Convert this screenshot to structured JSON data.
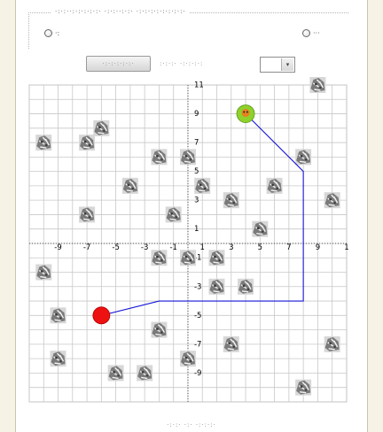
{
  "header": {
    "legend": "·:·:··:·:·:·:·:·  ·:·:··:·:·  ·:·:·:·:·:·:·:·:·",
    "option_left_label": "·:",
    "option_right_label": "···",
    "generate_button": "·:·:·:·:·:·",
    "level_label": ":·:·:· ·:·:·:·:",
    "level_value": ""
  },
  "footer": {
    "text": "·:·:· ·:· ·:·:·:·"
  },
  "board": {
    "x_range": [
      -11,
      11
    ],
    "y_range": [
      -11,
      11
    ],
    "grid_step": 1,
    "x_ticks": [
      "-9",
      "-7",
      "-5",
      "-3",
      "-1",
      "1",
      "3",
      "5",
      "7",
      "9",
      "1"
    ],
    "y_ticks": [
      "11",
      "9",
      "7",
      "5",
      "3",
      "1",
      "-1",
      "-3",
      "-5",
      "-7",
      "-9"
    ],
    "start_point": {
      "x": 4,
      "y": 9,
      "color": "#8fd12b"
    },
    "goal_point": {
      "x": -6,
      "y": -5,
      "color": "#ee1111"
    },
    "path_color": "#1515d6",
    "path": [
      [
        4,
        9
      ],
      [
        8,
        5
      ],
      [
        8,
        -4
      ],
      [
        -2,
        -4
      ],
      [
        -6,
        -5
      ]
    ],
    "obstacle_icon": "boulder-icon",
    "obstacles": [
      [
        9,
        11
      ],
      [
        -6,
        8
      ],
      [
        -10,
        7
      ],
      [
        -7,
        7
      ],
      [
        -2,
        6
      ],
      [
        0,
        6
      ],
      [
        8,
        6
      ],
      [
        -4,
        4
      ],
      [
        1,
        4
      ],
      [
        3,
        3
      ],
      [
        6,
        4
      ],
      [
        10,
        3
      ],
      [
        -7,
        2
      ],
      [
        -1,
        2
      ],
      [
        5,
        1
      ],
      [
        -2,
        -1
      ],
      [
        0,
        -1
      ],
      [
        2,
        -1
      ],
      [
        -10,
        -2
      ],
      [
        2,
        -3
      ],
      [
        4,
        -3
      ],
      [
        -9,
        -5
      ],
      [
        -2,
        -6
      ],
      [
        3,
        -7
      ],
      [
        10,
        -7
      ],
      [
        -9,
        -8
      ],
      [
        0,
        -8
      ],
      [
        -5,
        -9
      ],
      [
        -3,
        -9
      ],
      [
        8,
        -10
      ]
    ]
  }
}
